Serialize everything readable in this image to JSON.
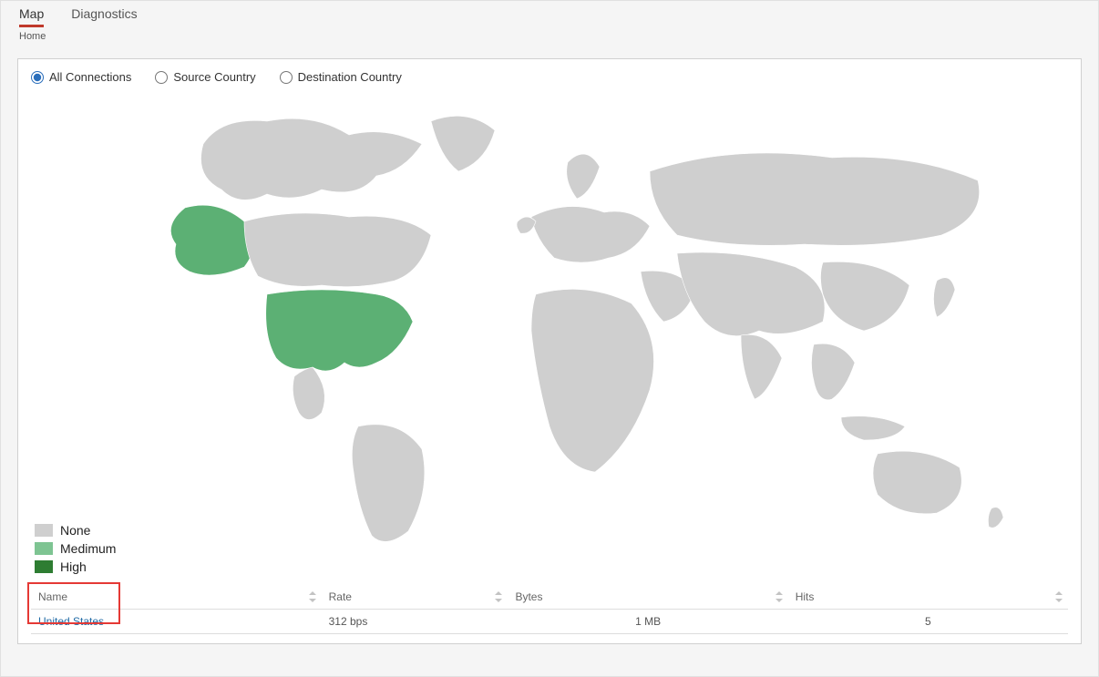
{
  "tabs": {
    "map": "Map",
    "diagnostics": "Diagnostics",
    "active": "map"
  },
  "breadcrumb": "Home",
  "filters": {
    "all": "All Connections",
    "source": "Source Country",
    "destination": "Destination Country",
    "selected": "all"
  },
  "legend": {
    "none": "None",
    "medium": "Medimum",
    "high": "High"
  },
  "colors": {
    "none": "#cfcfcf",
    "medium": "#7ec492",
    "high": "#2e7d32",
    "highlight_country": "#5cb074",
    "accent_tab": "#c0392b",
    "radio_accent": "#2a6ebb",
    "link": "#1f6aa5",
    "annotation": "#e53935"
  },
  "table": {
    "headers": {
      "name": "Name",
      "rate": "Rate",
      "bytes": "Bytes",
      "hits": "Hits"
    },
    "rows": [
      {
        "name": "United States",
        "rate": "312 bps",
        "bytes": "1 MB",
        "hits": "5"
      }
    ]
  },
  "map": {
    "highlighted_countries": [
      "United States"
    ]
  },
  "chart_data": {
    "type": "table",
    "columns": [
      "Name",
      "Rate",
      "Bytes",
      "Hits"
    ],
    "rows": [
      [
        "United States",
        "312 bps",
        "1 MB",
        5
      ]
    ]
  }
}
